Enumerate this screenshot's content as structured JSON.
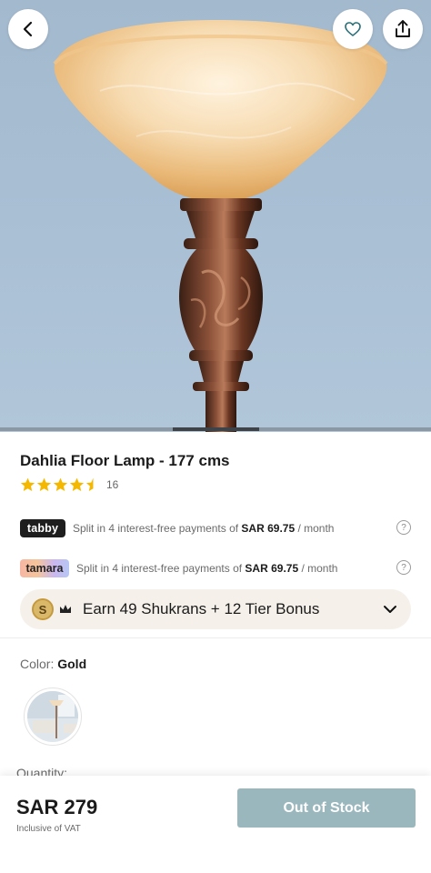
{
  "product": {
    "title": "Dahlia Floor Lamp - 177 cms",
    "rating": 4.5,
    "review_count": "16",
    "image_count": 5,
    "active_image": 3
  },
  "installments": {
    "tabby": {
      "logo": "tabby",
      "text_prefix": "Split in 4 interest-free payments of ",
      "amount": "SAR 69.75",
      "suffix": " / month"
    },
    "tamara": {
      "logo": "tamara",
      "text_prefix": "Split in 4 interest-free payments of ",
      "amount": "SAR 69.75",
      "suffix": " / month"
    }
  },
  "shukran": {
    "coin_letter": "S",
    "text": "Earn 49 Shukrans + 12 Tier Bonus"
  },
  "color": {
    "label": "Color: ",
    "value": "Gold"
  },
  "quantity": {
    "label": "Quantity:"
  },
  "footer": {
    "price": "SAR 279",
    "vat_note": "Inclusive of VAT",
    "button_label": "Out of Stock"
  },
  "icons": {
    "back": "chevron-left-icon",
    "wishlist": "heart-icon",
    "share": "share-icon",
    "help": "question-circle-icon",
    "expand": "chevron-down-icon",
    "crown": "crown-icon"
  },
  "colors": {
    "accent_teal": "#9ab7be",
    "star": "#f5b800",
    "hero_bg": "#a9bfd4"
  }
}
